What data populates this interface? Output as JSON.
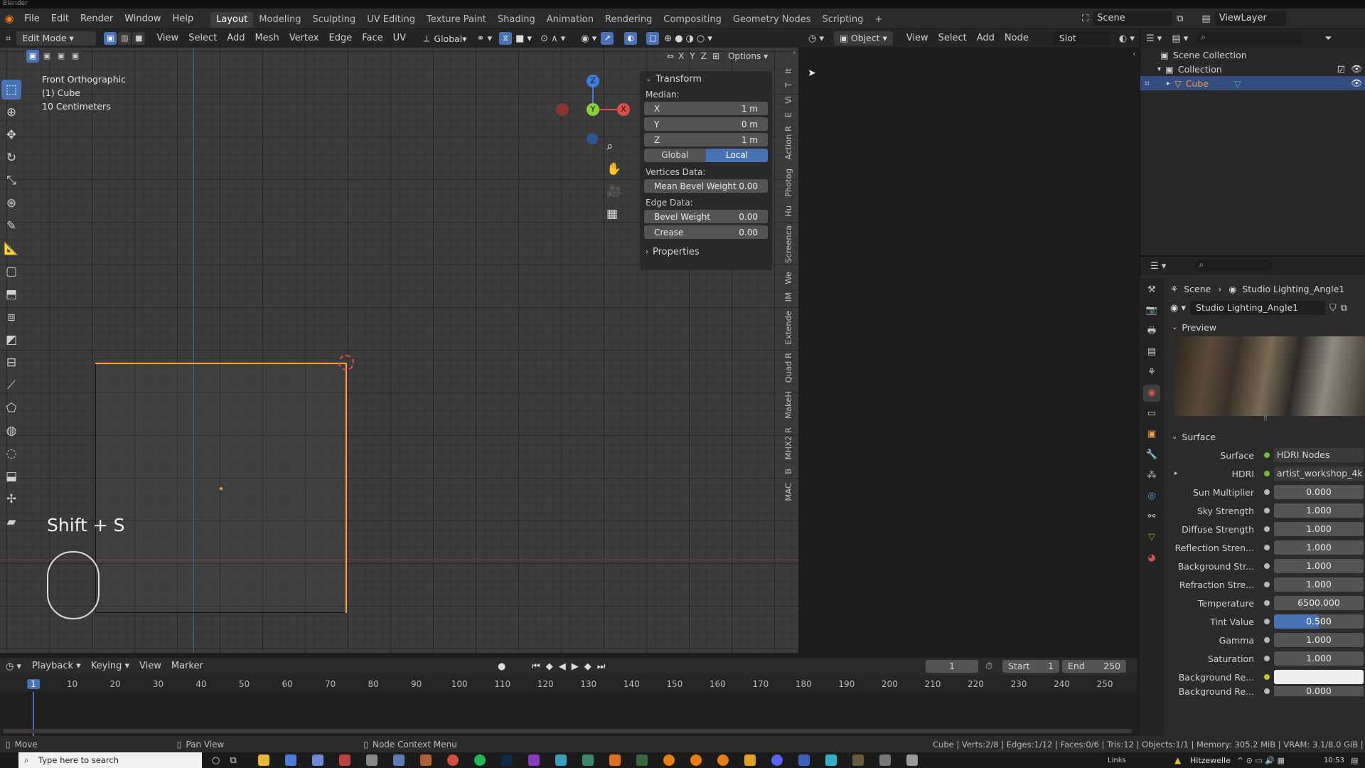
{
  "titlebar": {
    "app": "Blender"
  },
  "menus": [
    "File",
    "Edit",
    "Render",
    "Window",
    "Help"
  ],
  "workspaces": [
    "Layout",
    "Modeling",
    "Sculpting",
    "UV Editing",
    "Texture Paint",
    "Shading",
    "Animation",
    "Rendering",
    "Compositing",
    "Geometry Nodes",
    "Scripting"
  ],
  "active_workspace": "Layout",
  "scene": {
    "name": "Scene",
    "view_layer": "ViewLayer"
  },
  "viewport_header": {
    "mode": "Edit Mode",
    "menus": [
      "View",
      "Select",
      "Add",
      "Mesh",
      "Vertex",
      "Edge",
      "Face",
      "UV"
    ],
    "transform_orientation": "Global",
    "axes": [
      "X",
      "Y",
      "Z"
    ],
    "options_label": "Options"
  },
  "viewport_info": {
    "view": "Front Orthographic",
    "object": "(1) Cube",
    "scale": "10 Centimeters"
  },
  "shortcut_overlay": "Shift + S",
  "gizmo": {
    "z": "Z",
    "y": "Y",
    "x": "X"
  },
  "npanel": {
    "transform_title": "Transform",
    "median_label": "Median:",
    "fields": [
      {
        "label": "X",
        "value": "1 m"
      },
      {
        "label": "Y",
        "value": "0 m"
      },
      {
        "label": "Z",
        "value": "1 m"
      }
    ],
    "space_global": "Global",
    "space_local": "Local",
    "vertices_label": "Vertices Data:",
    "mean_bevel_label": "Mean Bevel Weight",
    "mean_bevel_value": "0.00",
    "edge_label": "Edge Data:",
    "bevel_weight_label": "Bevel Weight",
    "bevel_weight_value": "0.00",
    "crease_label": "Crease",
    "crease_value": "0.00",
    "properties_title": "Properties"
  },
  "side_tabs": [
    "It",
    "T",
    "Vi",
    "E",
    "Action R",
    "Photog",
    "Hu",
    "Screenca",
    "We",
    "IM",
    "Extende",
    "Quad R",
    "MakeH",
    "MHX2 R",
    "B",
    "MAC"
  ],
  "node_header": {
    "object_label": "Object",
    "menus": [
      "View",
      "Select",
      "Add",
      "Node"
    ],
    "slot": "Slot"
  },
  "outliner": {
    "scene_collection": "Scene Collection",
    "collection": "Collection",
    "cube": "Cube"
  },
  "properties": {
    "breadcrumb_scene": "Scene",
    "breadcrumb_world": "Studio Lighting_Angle1",
    "world_name": "Studio Lighting_Angle1",
    "preview_label": "Preview",
    "surface_section": "Surface",
    "surface_label": "Surface",
    "surface_value": "HDRI Nodes",
    "hdri_label": "HDRI",
    "hdri_value": "artist_workshop_4k....",
    "rows": [
      {
        "label": "Sun Multiplier",
        "value": "0.000"
      },
      {
        "label": "Sky Strength",
        "value": "1.000"
      },
      {
        "label": "Diffuse Strength",
        "value": "1.000"
      },
      {
        "label": "Reflection Stren...",
        "value": "1.000"
      },
      {
        "label": "Background Str...",
        "value": "1.000"
      },
      {
        "label": "Refraction Stre...",
        "value": "1.000"
      },
      {
        "label": "Temperature",
        "value": "6500.000"
      },
      {
        "label": "Tint Value",
        "value": "0.500"
      },
      {
        "label": "Gamma",
        "value": "1.000"
      },
      {
        "label": "Saturation",
        "value": "1.000"
      }
    ],
    "tint_fraction": 0.5,
    "bg_re_label": "Background Re...",
    "bg_re_color": "#eeeeee",
    "bg_re2_label": "Background Re...",
    "bg_re2_value": "0.000"
  },
  "timeline": {
    "menus": [
      "Playback",
      "Keying",
      "View",
      "Marker"
    ],
    "current_frame": "1",
    "start_label": "Start",
    "start_value": "1",
    "end_label": "End",
    "end_value": "250",
    "ruler": [
      "1",
      "10",
      "20",
      "30",
      "40",
      "50",
      "60",
      "70",
      "80",
      "90",
      "100",
      "110",
      "120",
      "130",
      "140",
      "150",
      "160",
      "170",
      "180",
      "190",
      "200",
      "210",
      "220",
      "230",
      "240",
      "250"
    ]
  },
  "statusbar": {
    "left": "Move",
    "mid": "Pan View",
    "right": "Node Context Menu",
    "stats": "Cube | Verts:2/8 | Edges:1/12 | Faces:0/6 | Tris:12 | Objects:1/1 | Memory: 305.2 MiB | VRAM: 3.1/8.0 GiB | 3.0"
  },
  "taskbar": {
    "search_placeholder": "Type here to search",
    "tray_links": "Links",
    "tray_app": "Hitzewelle",
    "time": "10:53"
  },
  "colors": {
    "accent": "#4772b3",
    "selected_edge": "#ffa32b",
    "x_axis": "#e04c4c",
    "y_axis": "#8bd135",
    "z_axis": "#3d7ce0"
  }
}
